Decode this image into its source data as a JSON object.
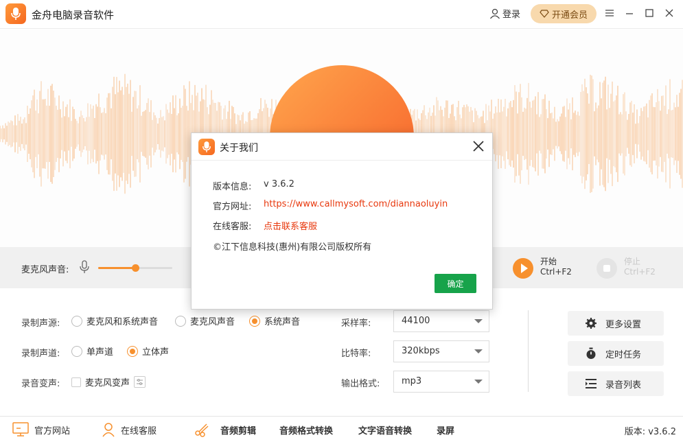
{
  "colors": {
    "accent": "#f7902d",
    "link_red": "#e8380d",
    "confirm_green": "#17a34a",
    "vip_bg": "#f8d9ad"
  },
  "app": {
    "title": "金舟电脑录音软件",
    "login": "登录",
    "vip": "开通会员"
  },
  "window_controls": [
    "menu-icon",
    "minimize-icon",
    "maximize-icon",
    "close-icon"
  ],
  "control": {
    "mic_label": "麦克风声音:",
    "mic_volume_fraction": 0.5,
    "start_label": "开始",
    "start_shortcut": "Ctrl+F2",
    "stop_label": "停止",
    "stop_shortcut": "Ctrl+F2"
  },
  "settings": {
    "source_label": "录制声源:",
    "source_options": [
      "麦克风和系统声音",
      "麦克风声音",
      "系统声音"
    ],
    "source_selected": "系统声音",
    "channel_label": "录制声道:",
    "channel_options": [
      "单声道",
      "立体声"
    ],
    "channel_selected": "立体声",
    "voice_change_label": "录音变声:",
    "voice_change_option": "麦克风变声",
    "voice_change_checked": false,
    "sample_rate_label": "采样率:",
    "sample_rate_value": "44100",
    "bitrate_label": "比特率:",
    "bitrate_value": "320kbps",
    "format_label": "输出格式:",
    "format_value": "mp3",
    "more_settings": "更多设置",
    "scheduled_task": "定时任务",
    "recording_list": "录音列表"
  },
  "bottom_bar": {
    "official_site": "官方网站",
    "online_service": "在线客服",
    "audio_edit": "音频剪辑",
    "format_convert": "音频格式转换",
    "tts": "文字语音转换",
    "screen_record": "录屏",
    "version": "版本: v3.6.2"
  },
  "about_dialog": {
    "title": "关于我们",
    "version_label": "版本信息:",
    "version_value": "v 3.6.2",
    "website_label": "官方网址:",
    "website_value": "https://www.callmysoft.com/diannaoluyin",
    "service_label": "在线客服:",
    "service_value": "点击联系客服",
    "copyright": "©江下信息科技(惠州)有限公司版权所有",
    "ok": "确定"
  }
}
